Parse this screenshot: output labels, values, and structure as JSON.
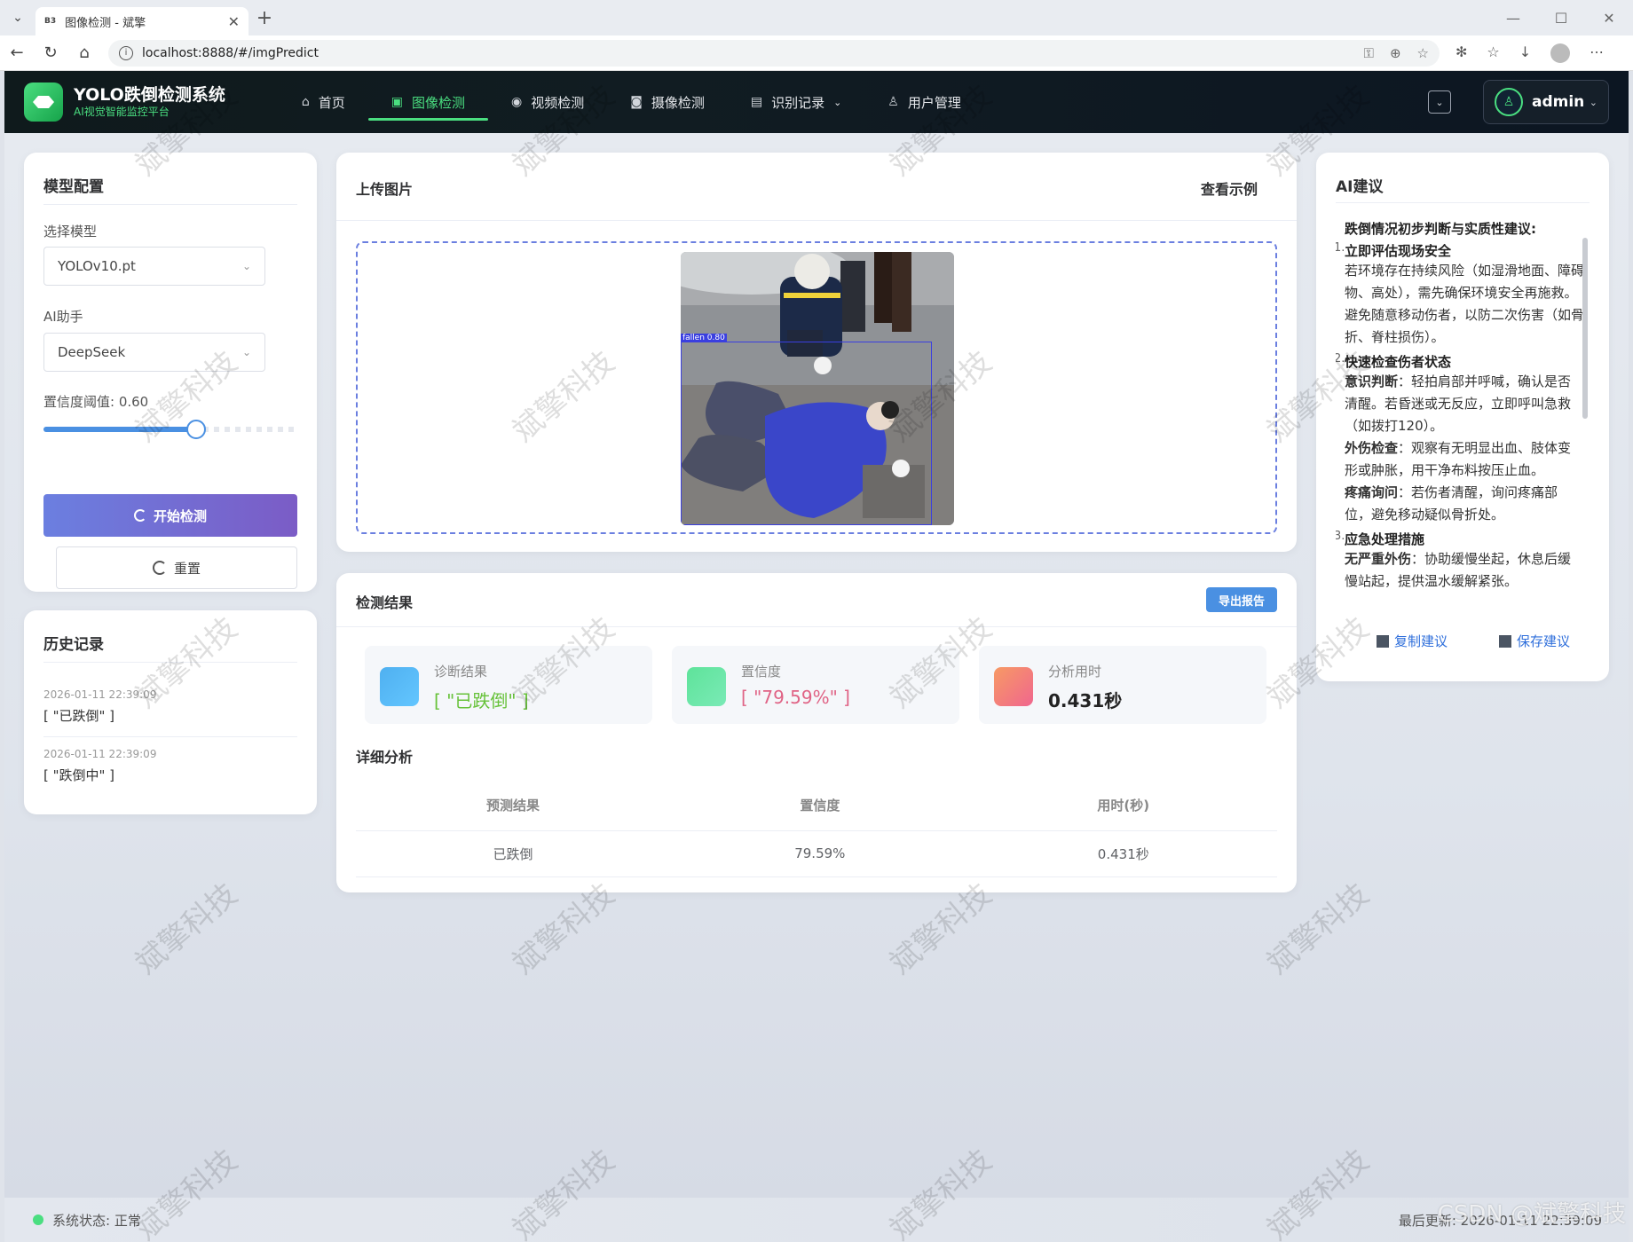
{
  "browser": {
    "tab_favicon": "B3",
    "tab_title": "图像检测 - 斌擎",
    "url": "localhost:8888/#/imgPredict"
  },
  "app": {
    "title": "YOLO跌倒检测系统",
    "subtitle": "AI视觉智能监控平台",
    "nav": [
      {
        "label": "首页",
        "icon": "home-icon"
      },
      {
        "label": "图像检测",
        "icon": "image-icon"
      },
      {
        "label": "视频检测",
        "icon": "play-icon"
      },
      {
        "label": "摄像检测",
        "icon": "camera-icon"
      },
      {
        "label": "识别记录",
        "icon": "document-icon"
      },
      {
        "label": "用户管理",
        "icon": "user-icon"
      }
    ],
    "user": "admin"
  },
  "config": {
    "title": "模型配置",
    "model_label": "选择模型",
    "model_value": "YOLOv10.pt",
    "ai_label": "AI助手",
    "ai_value": "DeepSeek",
    "threshold_label": "置信度阈值: 0.60",
    "threshold": 0.6,
    "start_button": "开始检测",
    "reset_button": "重置"
  },
  "history": {
    "title": "历史记录",
    "items": [
      {
        "time": "2026-01-11 22:39:09",
        "value": "[ \"已跌倒\" ]"
      },
      {
        "time": "2026-01-11 22:39:09",
        "value": "[ \"跌倒中\" ]"
      }
    ]
  },
  "upload": {
    "title": "上传图片",
    "example_link": "查看示例",
    "detection_label": "fallen 0.80"
  },
  "results": {
    "title": "检测结果",
    "export_button": "导出报告",
    "stats": [
      {
        "label": "诊断结果",
        "value": "[ \"已跌倒\" ]",
        "color": "#67c23a"
      },
      {
        "label": "置信度",
        "value": "[ \"79.59%\" ]",
        "color": "#e06385"
      },
      {
        "label": "分析用时",
        "value": "0.431秒",
        "color": "#222222"
      }
    ],
    "detail_title": "详细分析",
    "columns": [
      "预测结果",
      "置信度",
      "用时(秒)"
    ],
    "rows": [
      [
        "已跌倒",
        "79.59%",
        "0.431秒"
      ]
    ]
  },
  "ai": {
    "title": "AI建议",
    "heading": "跌倒情况初步判断与实质性建议:",
    "sections": [
      {
        "num": "1.",
        "title": "立即评估现场安全"
      },
      {
        "num": "2.",
        "title": "快速检查伤者状态"
      },
      {
        "num": "3.",
        "title": "应急处理措施"
      }
    ],
    "p1": "若环境存在持续风险（如湿滑地面、障碍物、高处），需先确保环境安全再施救。",
    "p2": "避免随意移动伤者，以防二次伤害（如骨折、脊柱损伤）。",
    "p3_k": "意识判断",
    "p3": "：轻拍肩部并呼喊，确认是否清醒。若昏迷或无反应，立即呼叫急救（如拨打120）。",
    "p4_k": "外伤检查",
    "p4": "：观察有无明显出血、肢体变形或肿胀，用干净布料按压止血。",
    "p5_k": "疼痛询问",
    "p5": "：若伤者清醒，询问疼痛部位，避免移动疑似骨折处。",
    "p6_k": "无严重外伤",
    "p6": "：协助缓慢坐起，休息后缓慢站起，提供温水缓解紧张。",
    "copy": "复制建议",
    "save": "保存建议"
  },
  "status": {
    "left": "系统状态: 正常",
    "right": "最后更新: 2026-01-11 22:39:09"
  },
  "watermark": "斌擎科技",
  "csdn": "CSDN @斌擎科技"
}
